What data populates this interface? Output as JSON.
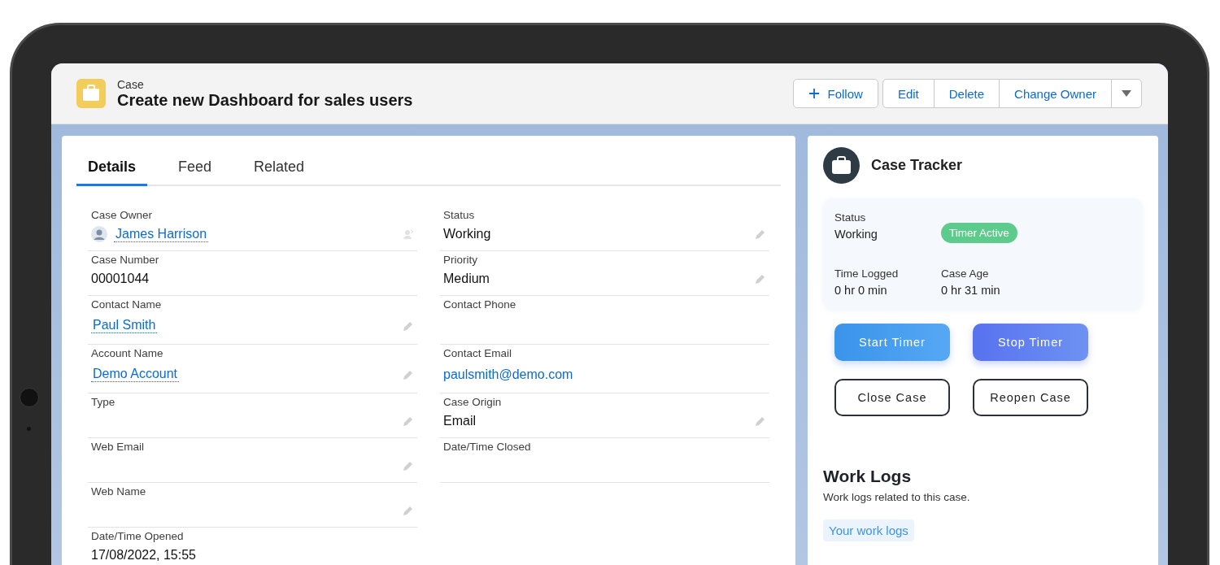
{
  "header": {
    "object_type": "Case",
    "title": "Create new Dashboard for sales users",
    "follow_button": {
      "label": "Follow"
    },
    "action_group": [
      "Edit",
      "Delete",
      "Change Owner"
    ],
    "more_menu": {
      "expanded": false
    }
  },
  "tabs": [
    {
      "label": "Details",
      "selected": true
    },
    {
      "label": "Feed",
      "selected": false
    },
    {
      "label": "Related",
      "selected": false
    }
  ],
  "fields_left": [
    {
      "label": "Case Owner",
      "value": "James Harrison",
      "kind": "owner",
      "editable": true
    },
    {
      "label": "Case Number",
      "value": "00001044",
      "kind": "text",
      "editable": false
    },
    {
      "label": "Contact Name",
      "value": "Paul Smith",
      "kind": "link",
      "editable": true
    },
    {
      "label": "Account Name",
      "value": "Demo Account",
      "kind": "link",
      "editable": true
    },
    {
      "label": "Type",
      "kind": "empty",
      "editable": true
    },
    {
      "label": "Web Email",
      "kind": "empty",
      "editable": true
    },
    {
      "label": "Web Name",
      "kind": "empty",
      "editable": true
    },
    {
      "label": "Date/Time Opened",
      "value": "17/08/2022, 15:55",
      "kind": "text",
      "editable": false
    }
  ],
  "fields_right": [
    {
      "label": "Status",
      "value": "Working",
      "kind": "text",
      "editable": true
    },
    {
      "label": "Priority",
      "value": "Medium",
      "kind": "text",
      "editable": true
    },
    {
      "label": "Contact Phone",
      "kind": "empty",
      "editable": false
    },
    {
      "label": "Contact Email",
      "value": "paulsmith@demo.com",
      "kind": "email",
      "editable": false
    },
    {
      "label": "Case Origin",
      "value": "Email",
      "kind": "text",
      "editable": true
    },
    {
      "label": "Date/Time Closed",
      "kind": "empty",
      "editable": false
    }
  ],
  "case_tracker": {
    "title": "Case Tracker",
    "status_label": "Status",
    "status_value": "Working",
    "badge": "Timer Active",
    "stats": [
      {
        "label": "Time Logged",
        "value": "0 hr 0 min"
      },
      {
        "label": "Case Age",
        "value": "0 hr 31 min"
      }
    ],
    "buttons": [
      {
        "label": "Start Timer",
        "kind": "blue"
      },
      {
        "label": "Stop Timer",
        "kind": "indigo"
      },
      {
        "label": "Close Case",
        "kind": "outline"
      },
      {
        "label": "Reopen Case",
        "kind": "outline"
      }
    ],
    "work_logs": {
      "title": "Work Logs",
      "description": "Work logs related to this case.",
      "link": "Your work logs"
    }
  }
}
